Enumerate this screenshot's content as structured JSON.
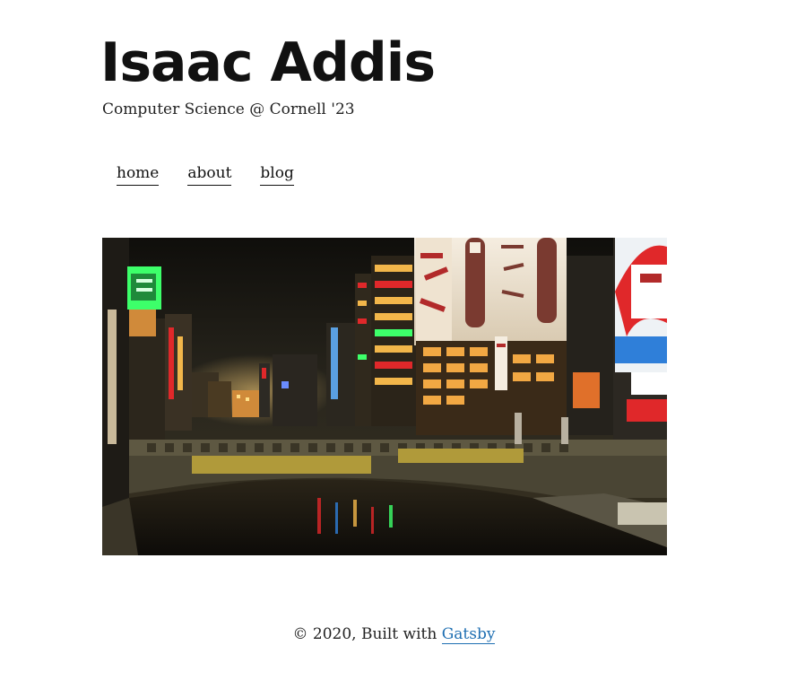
{
  "header": {
    "title": "Isaac Addis",
    "subtitle": "Computer Science @ Cornell '23"
  },
  "nav": {
    "items": [
      {
        "label": "home"
      },
      {
        "label": "about"
      },
      {
        "label": "blog"
      }
    ]
  },
  "hero": {
    "alt": "Night city canal scene with neon signs",
    "colors": {
      "sky": "#1c1a14",
      "neon_green": "#3dff6a",
      "neon_red": "#e0282a",
      "neon_blue": "#2f7fd9",
      "warm_light": "#f2b64a"
    }
  },
  "footer": {
    "prefix": "© 2020, Built with ",
    "link_label": "Gatsby",
    "link_color": "#1f6fb2"
  }
}
